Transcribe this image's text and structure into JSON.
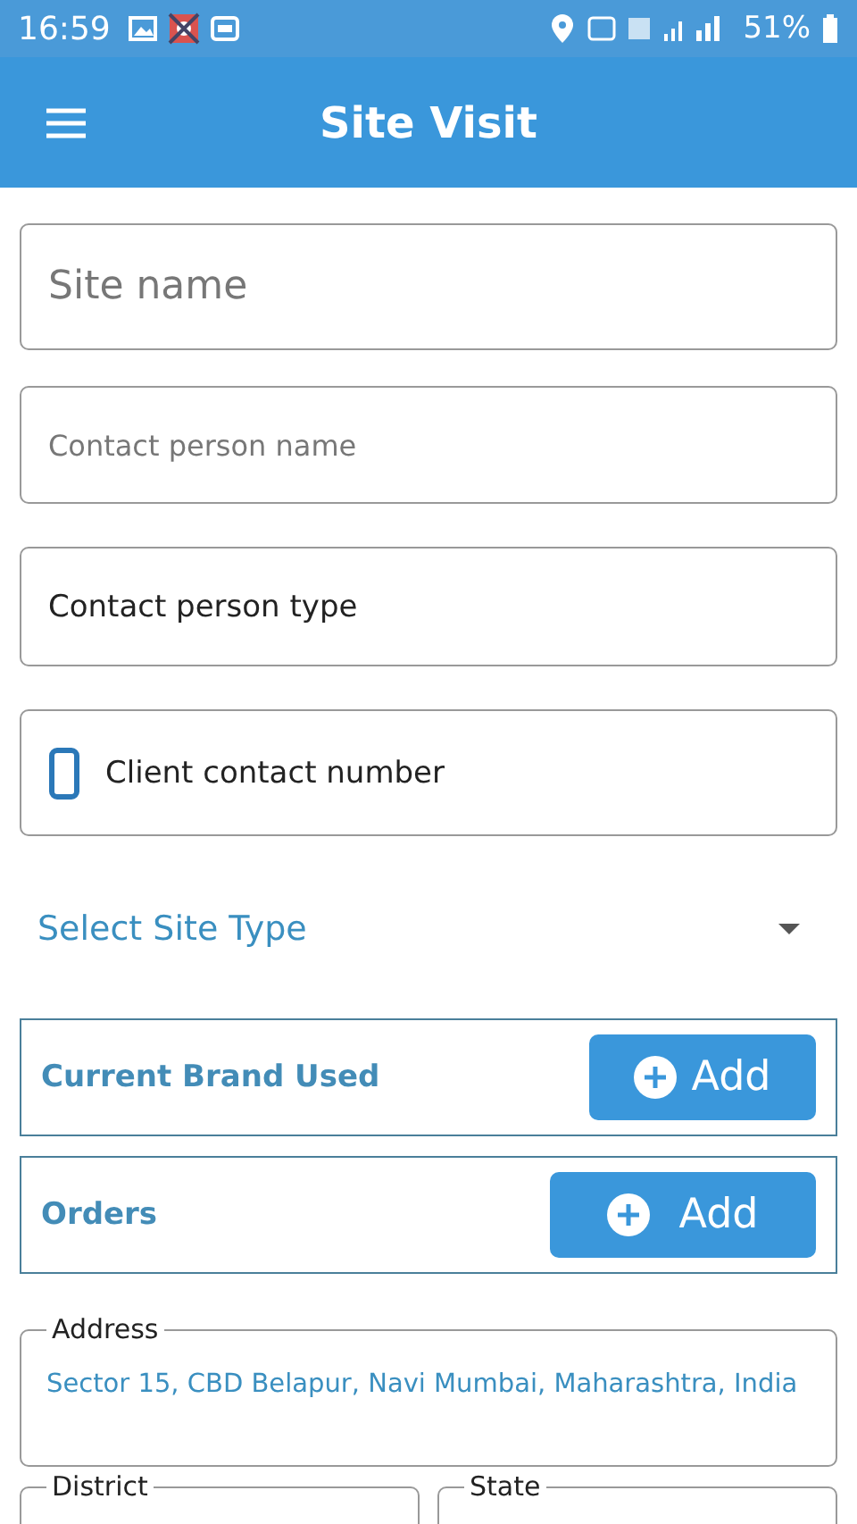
{
  "status_bar": {
    "time": "16:59",
    "battery": "51%"
  },
  "app_bar": {
    "title": "Site Visit"
  },
  "fields": [
    {
      "kind": "heading",
      "placeholder": "Site name"
    },
    {
      "kind": "placeholder",
      "placeholder": "Contact person name"
    },
    {
      "kind": "value",
      "value": "Contact person type"
    },
    {
      "kind": "phone",
      "value": "Client contact number"
    }
  ],
  "site_type": {
    "placeholder": "Select Site Type"
  },
  "add_rows": [
    {
      "label": "Current Brand Used",
      "button": "Add"
    },
    {
      "label": "Orders",
      "button": "Add"
    }
  ],
  "address": {
    "label": "Address",
    "value": "Sector 15, CBD Belapur, Navi Mumbai, Maharashtra, India"
  },
  "bottom_fields": [
    {
      "label": "District"
    },
    {
      "label": "State"
    }
  ]
}
